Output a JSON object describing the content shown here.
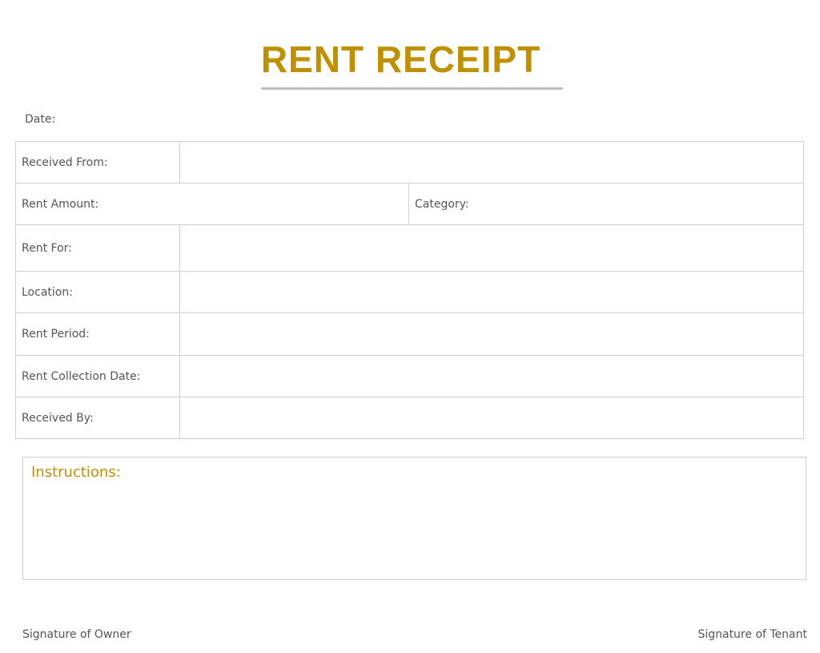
{
  "document": {
    "title": "RENT RECEIPT",
    "date_label": "Date:",
    "accent_color": "#BF9000"
  },
  "fields": {
    "received_from": "Received From:",
    "rent_amount": "Rent Amount:",
    "category": "Category:",
    "rent_for": "Rent For:",
    "location": "Location:",
    "rent_period": "Rent Period:",
    "rent_collection_date": "Rent Collection Date:",
    "received_by": "Received By:"
  },
  "instructions": {
    "label": "Instructions:"
  },
  "signatures": {
    "owner": "Signature of Owner",
    "tenant": "Signature of Tenant"
  }
}
